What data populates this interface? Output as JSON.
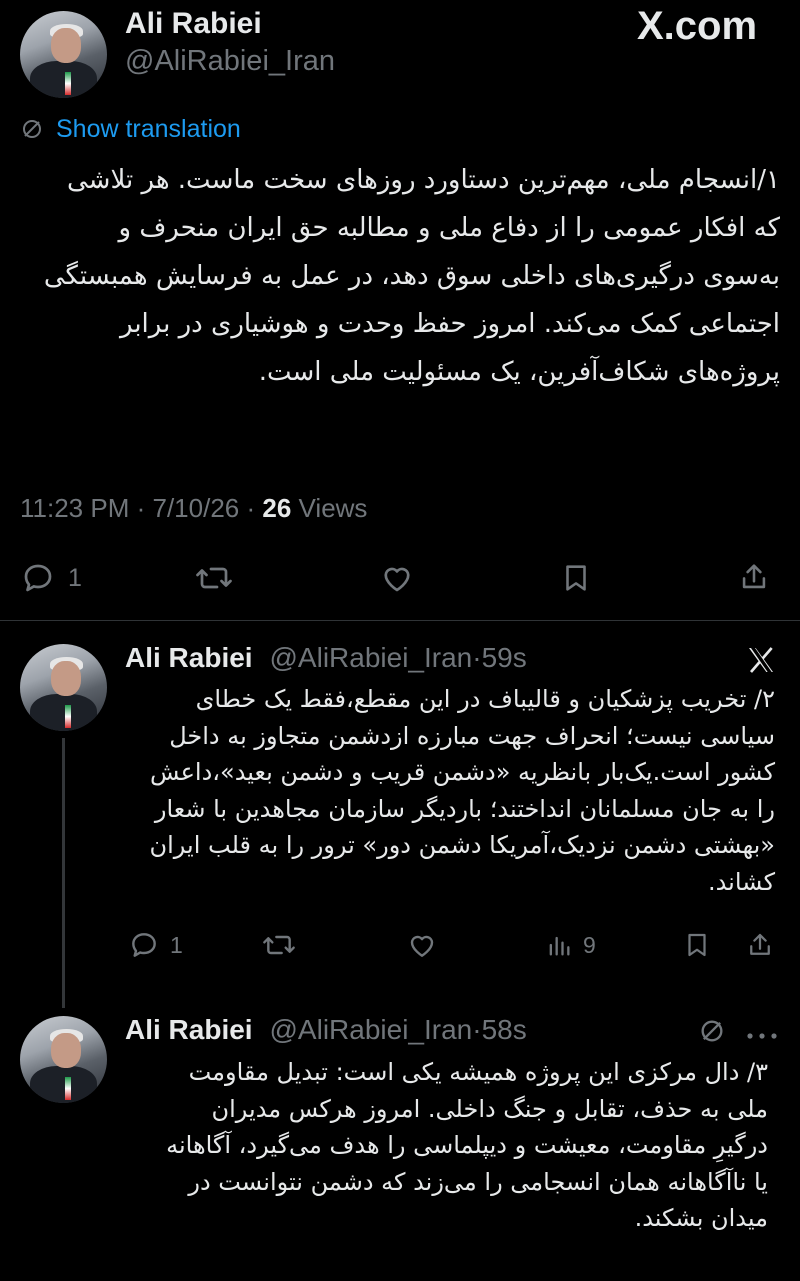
{
  "brand": {
    "label": "X.com"
  },
  "main_tweet": {
    "author": {
      "name": "Ali Rabiei",
      "handle": "@AliRabiei_Iran"
    },
    "show_translation": "Show translation",
    "text": "۱/انسجام ملی، مهم‌ترین دستاورد روزهای سخت ماست. هر تلاشی که افکار عمومی را از دفاع ملی و مطالبه حق ایران منحرف و به‌سوی درگیری‌های داخلی سوق دهد، در عمل به فرسایش همبستگی اجتماعی کمک می‌کند. امروز حفظ وحدت و هوشیاری در برابر پروژه‌های شکاف‌آفرین، یک مسئولیت ملی است.",
    "meta": {
      "time": "11:23 PM",
      "date": "7/10/26",
      "views_count": "26",
      "views_label": "Views",
      "sep": "·"
    },
    "actions": {
      "replies": "1"
    }
  },
  "reply_1": {
    "author": {
      "name": "Ali Rabiei",
      "handle": "@AliRabiei_Iran"
    },
    "time": "59s",
    "text": "۲/ تخریب پزشکیان و قالیباف در این مقطع،فقط یک خطای سیاسی نیست؛ انحراف جهت مبارزه ازدشمن متجاوز به داخل کشور است.یک‌بار بانظریه «دشمن قریب و دشمن بعید»،داعش را به جان مسلمانان انداختند؛ باردیگر سازمان مجاهدین با شعار «بهشتی دشمن نزدیک،آمریکا دشمن دور» ترور را به قلب ایران کشاند.",
    "actions": {
      "replies": "1",
      "views": "9"
    }
  },
  "reply_2": {
    "author": {
      "name": "Ali Rabiei",
      "handle": "@AliRabiei_Iran"
    },
    "time": "58s",
    "text": "۳/ دال مرکزی این پروژه همیشه یکی است: تبدیل مقاومت ملی به حذف، تقابل و جنگ داخلی. امروز هرکس مدیران درگیرِ مقاومت، معیشت و دیپلماسی را هدف می‌گیرد، آگاهانه یا ناآگاهانه همان انسجامی را می‌زند که دشمن نتوانست در میدان بشکند."
  },
  "colors": {
    "background": "#000000",
    "text": "#e7e9ea",
    "muted": "#71767b",
    "link": "#1d9bf0",
    "divider": "#2f3336"
  }
}
